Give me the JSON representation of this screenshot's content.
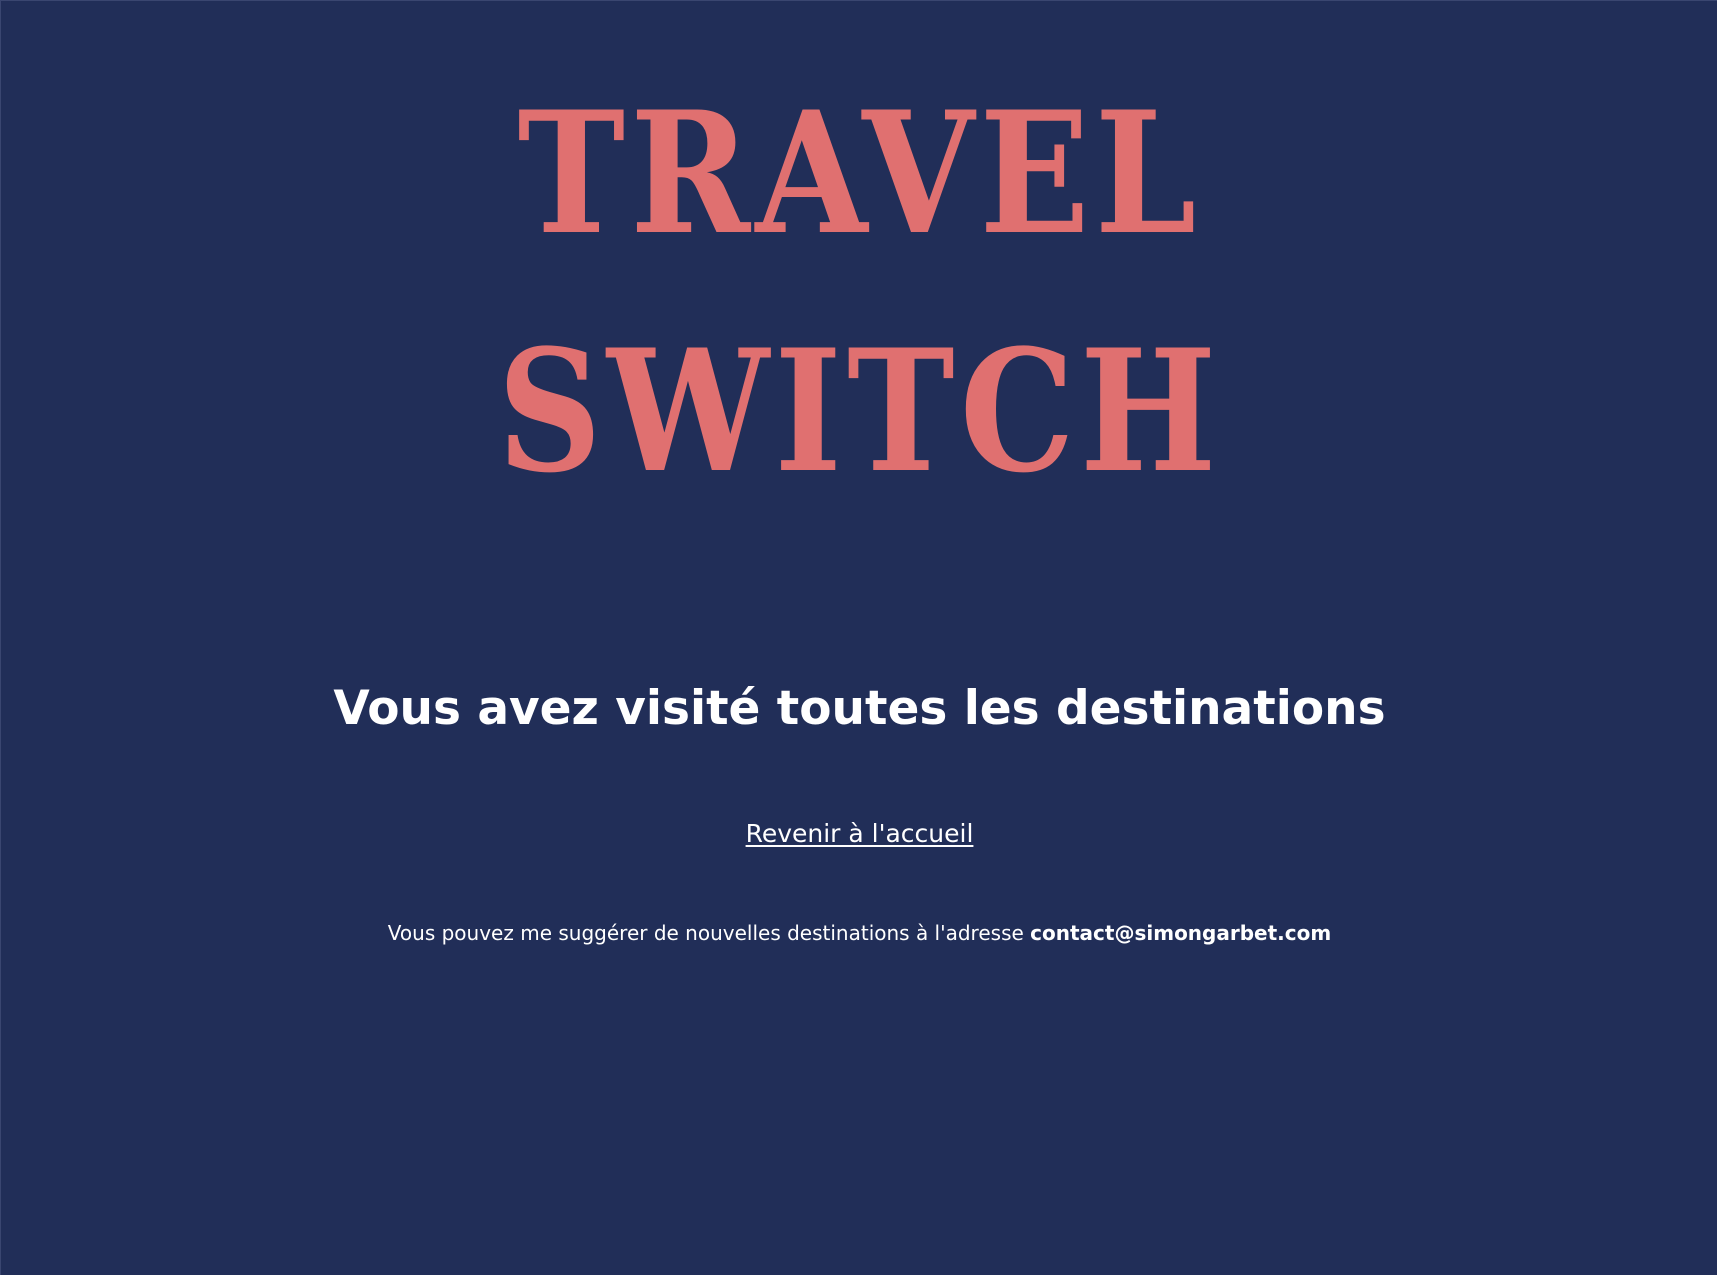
{
  "logo": {
    "line1": "TRAVEL",
    "line2": "SWITCH"
  },
  "main": {
    "heading": "Vous avez visité toutes les destinations",
    "home_link_label": "Revenir à l'accueil",
    "suggestion_text": "Vous pouvez me suggérer de nouvelles destinations à l'adresse",
    "contact_email": "contact@simongarbet.com"
  },
  "colors": {
    "background": "#212e58",
    "logo": "#e07070",
    "text": "#ffffff"
  }
}
